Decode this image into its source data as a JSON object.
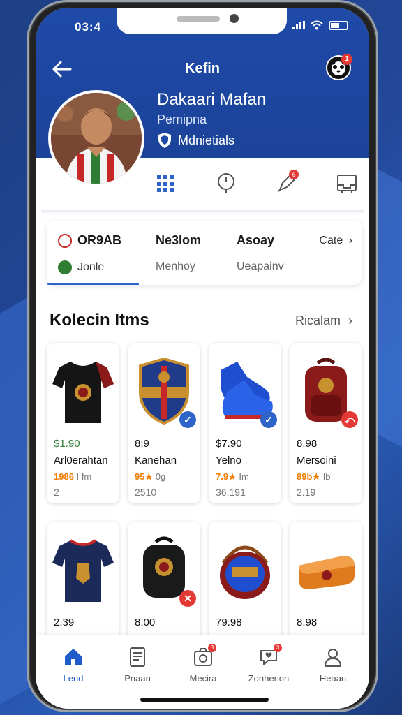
{
  "status_bar": {
    "time": "03:4"
  },
  "header": {
    "title": "Kefin",
    "logo_badge": "1"
  },
  "profile": {
    "name": "Dakaari Mafan",
    "subtitle": "Pemipna",
    "club": "Mdnietials"
  },
  "actions": [
    {
      "icon": "grid-icon",
      "badge": ""
    },
    {
      "icon": "pin-icon",
      "badge": ""
    },
    {
      "icon": "rocket-icon",
      "badge": "6"
    },
    {
      "icon": "tray-icon",
      "badge": ""
    }
  ],
  "stats": {
    "col1_main": "OR9AB",
    "col1_sub": "Jonle",
    "col2_main": "Ne3lom",
    "col2_sub": "Menhoy",
    "col3_main": "Asoay",
    "col3_sub": "Ueapainv",
    "more": "Cate"
  },
  "collection": {
    "title": "Kolecin Itms",
    "link": "Ricalam"
  },
  "items": [
    {
      "price": "$1.90",
      "name": "Arl0erahtan",
      "rating_stars": "1986",
      "rating_rest": "I fm",
      "meta": "2",
      "thumb": "jersey-icon",
      "badge_color": "",
      "price_color": "green"
    },
    {
      "price": "8:9",
      "name": "Kanehan",
      "rating_stars": "95★",
      "rating_rest": "0g",
      "meta": "2510",
      "thumb": "crest-icon",
      "badge_color": "#2e64c7",
      "price_color": ""
    },
    {
      "price": "$7.90",
      "name": "Yelno",
      "rating_stars": "7.9★",
      "rating_rest": "Im",
      "meta": "36.191",
      "thumb": "boots-icon",
      "badge_color": "#2e64c7",
      "price_color": ""
    },
    {
      "price": "8.98",
      "name": "Mersoini",
      "rating_stars": "89b★",
      "rating_rest": "Ib",
      "meta": "2.19",
      "thumb": "backpack-icon",
      "badge_color": "#e53935",
      "price_color": ""
    },
    {
      "price": "2.39",
      "name": "",
      "rating_stars": "",
      "rating_rest": "",
      "meta": "",
      "thumb": "jersey-navy-icon",
      "badge_color": "",
      "price_color": ""
    },
    {
      "price": "8.00",
      "name": "",
      "rating_stars": "",
      "rating_rest": "",
      "meta": "",
      "thumb": "backpack-black-icon",
      "badge_color": "#e53935",
      "price_color": ""
    },
    {
      "price": "79.98",
      "name": "",
      "rating_stars": "",
      "rating_rest": "",
      "meta": "",
      "thumb": "bag-icon",
      "badge_color": "",
      "price_color": ""
    },
    {
      "price": "8.98",
      "name": "",
      "rating_stars": "",
      "rating_rest": "",
      "meta": "",
      "thumb": "case-icon",
      "badge_color": "",
      "price_color": ""
    }
  ],
  "bottom_nav": [
    {
      "label": "Lend",
      "icon": "home-icon",
      "active": true,
      "badge": ""
    },
    {
      "label": "Pnaan",
      "icon": "document-icon",
      "active": false,
      "badge": ""
    },
    {
      "label": "Mecira",
      "icon": "camera-icon",
      "active": false,
      "badge": "3"
    },
    {
      "label": "Zonhenon",
      "icon": "chat-heart-icon",
      "active": false,
      "badge": "3"
    },
    {
      "label": "Heaan",
      "icon": "profile-icon",
      "active": false,
      "badge": ""
    }
  ],
  "colors": {
    "brand": "#1f4aa8",
    "accent": "#2e64c7",
    "alert": "#e53935",
    "rating": "#f07c00"
  }
}
